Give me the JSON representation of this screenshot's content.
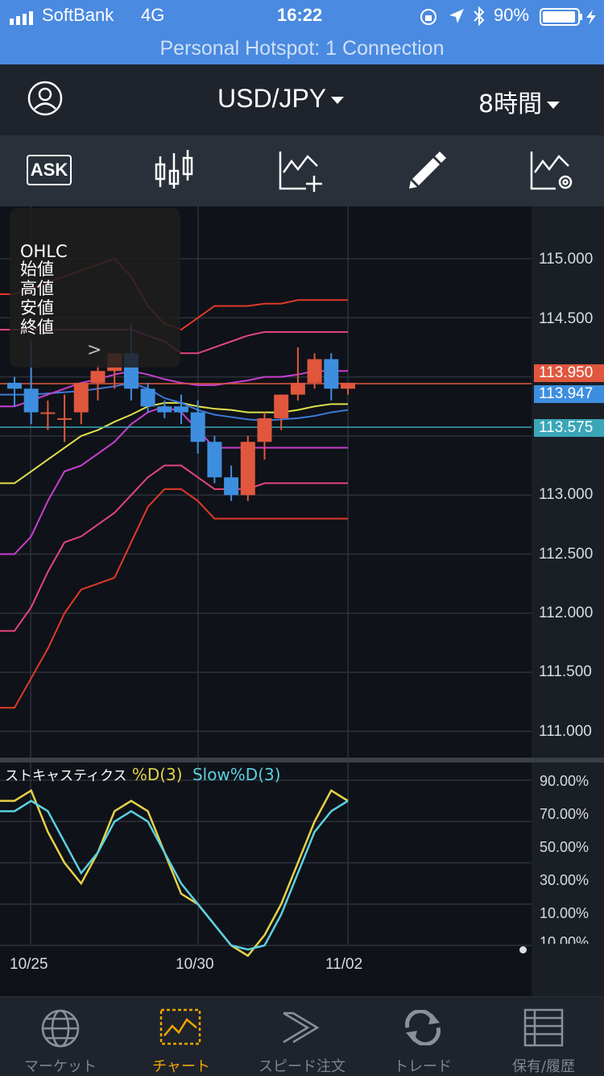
{
  "status_bar": {
    "carrier": "SoftBank",
    "network": "4G",
    "time": "16:22",
    "battery": "90%",
    "hotspot": "Personal Hotspot: 1 Connection"
  },
  "header": {
    "pair": "USD/JPY",
    "timeframe": "8時間"
  },
  "toolbar": {
    "ask_label": "ASK"
  },
  "ohlc_panel": {
    "title": "OHLC",
    "lines": [
      "始値",
      "高値",
      "安値",
      "終値"
    ],
    "expand": ">"
  },
  "price_axis": [
    "115.000",
    "114.500",
    "113.000",
    "112.500",
    "112.000",
    "111.500",
    "111.000"
  ],
  "price_tags": {
    "bid": "113.950",
    "mid": "113.947",
    "line": "113.575"
  },
  "date_axis": [
    "10/25",
    "10/30",
    "11/02"
  ],
  "oscillator": {
    "title": "ストキャスティクス",
    "series_d": "%D(3)",
    "series_slow": "Slow%D(3)",
    "levels": [
      "90.00%",
      "70.00%",
      "50.00%",
      "30.00%",
      "10.00%",
      "10.00%"
    ]
  },
  "tabs": [
    {
      "label": "マーケット",
      "icon": "globe-icon"
    },
    {
      "label": "チャート",
      "icon": "chart-icon"
    },
    {
      "label": "スピード注文",
      "icon": "speed-icon"
    },
    {
      "label": "トレード",
      "icon": "trade-icon"
    },
    {
      "label": "保有/履歴",
      "icon": "list-icon"
    }
  ],
  "chart_data": {
    "type": "candlestick",
    "candles": [
      {
        "date": "10/25",
        "o": 113.95,
        "h": 114.0,
        "l": 113.75,
        "c": 113.9
      },
      {
        "o": 113.9,
        "h": 114.3,
        "l": 113.6,
        "c": 113.7
      },
      {
        "o": 113.7,
        "h": 113.8,
        "l": 113.55,
        "c": 113.7
      },
      {
        "o": 113.65,
        "h": 113.85,
        "l": 113.45,
        "c": 113.65
      },
      {
        "o": 113.7,
        "h": 113.9,
        "l": 113.6,
        "c": 113.95
      },
      {
        "o": 113.95,
        "h": 114.1,
        "l": 113.8,
        "c": 114.05
      },
      {
        "o": 114.05,
        "h": 114.2,
        "l": 113.9,
        "c": 114.2
      },
      {
        "o": 114.2,
        "h": 114.45,
        "l": 113.8,
        "c": 113.9
      },
      {
        "o": 113.9,
        "h": 113.95,
        "l": 113.7,
        "c": 113.75
      },
      {
        "o": 113.75,
        "h": 113.8,
        "l": 113.65,
        "c": 113.7
      },
      {
        "date": "10/30",
        "o": 113.75,
        "h": 113.85,
        "l": 113.6,
        "c": 113.7
      },
      {
        "o": 113.7,
        "h": 113.8,
        "l": 113.35,
        "c": 113.45
      },
      {
        "o": 113.45,
        "h": 113.5,
        "l": 113.1,
        "c": 113.15
      },
      {
        "o": 113.15,
        "h": 113.25,
        "l": 112.95,
        "c": 113.0
      },
      {
        "o": 113.0,
        "h": 113.5,
        "l": 112.95,
        "c": 113.45
      },
      {
        "o": 113.45,
        "h": 113.7,
        "l": 113.3,
        "c": 113.65
      },
      {
        "o": 113.65,
        "h": 113.85,
        "l": 113.55,
        "c": 113.85
      },
      {
        "o": 113.85,
        "h": 114.25,
        "l": 113.8,
        "c": 113.95
      },
      {
        "o": 113.95,
        "h": 114.2,
        "l": 113.9,
        "c": 114.15
      },
      {
        "o": 114.15,
        "h": 114.2,
        "l": 113.8,
        "c": 113.9
      },
      {
        "date": "11/02",
        "o": 113.9,
        "h": 113.95,
        "l": 113.85,
        "c": 113.95
      }
    ],
    "bands": [
      {
        "color": "#e03a2a",
        "values": [
          111.2,
          111.45,
          111.7,
          112.0,
          112.2,
          112.25,
          112.3,
          112.6,
          112.9,
          113.05,
          113.05,
          112.95,
          112.8,
          112.8,
          112.8,
          112.8,
          112.8,
          112.8,
          112.8,
          112.8,
          112.8
        ]
      },
      {
        "color": "#e3467c",
        "values": [
          111.85,
          112.05,
          112.35,
          112.6,
          112.65,
          112.75,
          112.85,
          113.0,
          113.15,
          113.25,
          113.25,
          113.15,
          113.05,
          113.05,
          113.05,
          113.1,
          113.1,
          113.1,
          113.1,
          113.1,
          113.1
        ]
      },
      {
        "color": "#c83fd0",
        "values": [
          112.5,
          112.65,
          112.95,
          113.2,
          113.25,
          113.35,
          113.45,
          113.6,
          113.7,
          113.75,
          113.7,
          113.55,
          113.4,
          113.4,
          113.4,
          113.4,
          113.4,
          113.4,
          113.4,
          113.4,
          113.4
        ]
      },
      {
        "color": "#e0e04a",
        "values": [
          113.1,
          113.2,
          113.3,
          113.4,
          113.5,
          113.55,
          113.62,
          113.68,
          113.75,
          113.78,
          113.78,
          113.75,
          113.73,
          113.72,
          113.7,
          113.7,
          113.7,
          113.72,
          113.75,
          113.77,
          113.77
        ]
      },
      {
        "color": "#3b7ad8",
        "values": [
          113.85,
          113.85,
          113.86,
          113.87,
          113.88,
          113.9,
          113.92,
          113.95,
          113.9,
          113.82,
          113.78,
          113.72,
          113.68,
          113.66,
          113.64,
          113.63,
          113.64,
          113.65,
          113.67,
          113.7,
          113.72
        ]
      },
      {
        "color": "#c83fd0",
        "values": [
          113.75,
          113.8,
          113.85,
          113.9,
          113.95,
          113.98,
          114.02,
          114.05,
          114.02,
          113.98,
          113.95,
          113.93,
          113.93,
          113.95,
          113.97,
          114.0,
          114.0,
          114.02,
          114.05,
          114.05,
          114.05
        ]
      },
      {
        "color": "#e3467c",
        "values": [
          114.4,
          114.4,
          114.4,
          114.4,
          114.4,
          114.4,
          114.4,
          114.4,
          114.35,
          114.3,
          114.2,
          114.2,
          114.25,
          114.3,
          114.35,
          114.38,
          114.38,
          114.38,
          114.38,
          114.38,
          114.38
        ]
      },
      {
        "color": "#e03a2a",
        "values": [
          114.7,
          114.75,
          114.8,
          114.85,
          114.9,
          114.95,
          115.0,
          114.85,
          114.6,
          114.45,
          114.4,
          114.5,
          114.6,
          114.6,
          114.6,
          114.62,
          114.62,
          114.65,
          114.65,
          114.65,
          114.65
        ]
      }
    ],
    "stochastic": {
      "d": [
        80,
        85,
        65,
        50,
        40,
        55,
        75,
        80,
        75,
        55,
        35,
        30,
        20,
        10,
        5,
        15,
        30,
        50,
        70,
        85,
        80
      ],
      "slow": [
        75,
        80,
        75,
        60,
        45,
        55,
        70,
        75,
        70,
        55,
        40,
        30,
        20,
        10,
        8,
        10,
        25,
        45,
        65,
        75,
        80
      ]
    },
    "ylim": [
      110.5,
      115.3
    ]
  }
}
